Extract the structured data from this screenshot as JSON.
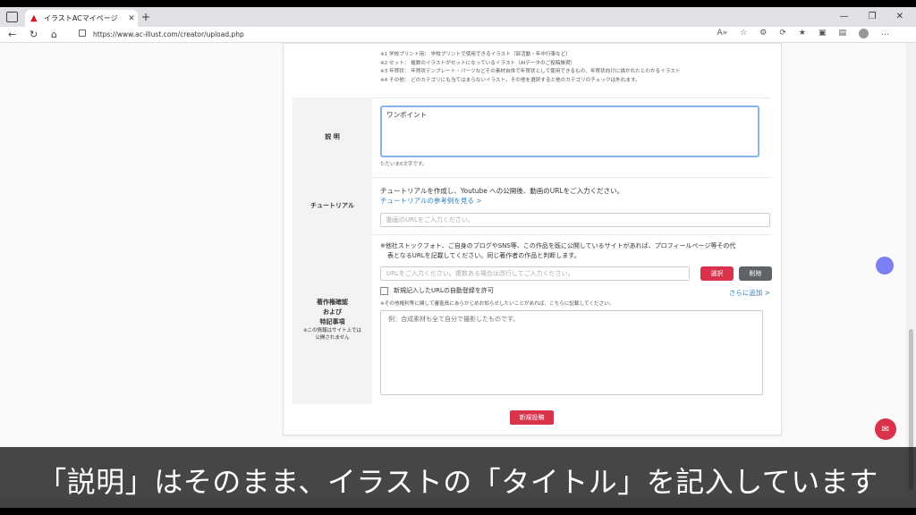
{
  "browser": {
    "tab_title": "イラストACマイページ",
    "tab_close": "✕",
    "new_tab": "+",
    "url": "https://www.ac-illust.com/creator/upload.php",
    "window_controls": [
      "—",
      "❐",
      "✕"
    ]
  },
  "form": {
    "category_notes": [
      "※1 学校プリント用： 学校プリントで使用できるイラスト（部活動・年中行事など）",
      "※2 セット： 複数のイラストがセットになっているイラスト（AIデータのご投稿推奨）",
      "※3 年賀状： 年賀状テンプレート・パーツなどその素材自体で年賀状として使用できるもの、年賀状向けに描かれたとわかるイラスト",
      "※4 その他： どのカテゴリにも当てはまらないイラスト。その他を選択すると他のカテゴリのチェックは外れます。"
    ],
    "description": {
      "label": "説 明",
      "value": "ワンポイント",
      "note": "ただいま6文字です。"
    },
    "tutorial": {
      "label": "チュートリアル",
      "text": "チュートリアルを作成し、Youtube への公開後、動画のURLをご入力ください。",
      "link": "チュートリアルの参考例を見る >",
      "placeholder": "動画のURLをご入力ください。"
    },
    "copyright": {
      "label_line1": "著作権確認",
      "label_line2": "および",
      "label_line3": "特記事項",
      "label_note_line1": "※この情報はサイト上では",
      "label_note_line2": "公開されません",
      "text_line1": "※他社ストックフォト、ご自身のブログやSNS等、この作品を既に公開しているサイトがあれば、プロフィールページ等その代",
      "text_line2": "表となるURLを記載してください。同じ著作者の作品と判断します。",
      "url_placeholder": "URLをご入力ください。複数ある場合は改行してご入力ください。",
      "select_button": "選択",
      "delete_button": "削除",
      "checkbox_label": "新規記入したURLの自動登録を許可",
      "add_more": "さらに追加 >",
      "notice": "※その他権利等に関して審査員にあらかじめお知らせしたいことがあれば、こちらに記載してください。",
      "textarea_placeholder": "例：合成素材も全て自分で撮影したものです。"
    },
    "submit_button": "新規投稿"
  },
  "subtitle": "「説明」はそのまま、イラストの「タイトル」を記入しています",
  "colors": {
    "accent_red": "#d8334a",
    "link_blue": "#2f7fc1",
    "focus_blue": "#8ab4e8",
    "delete_gray": "#5f6368"
  }
}
